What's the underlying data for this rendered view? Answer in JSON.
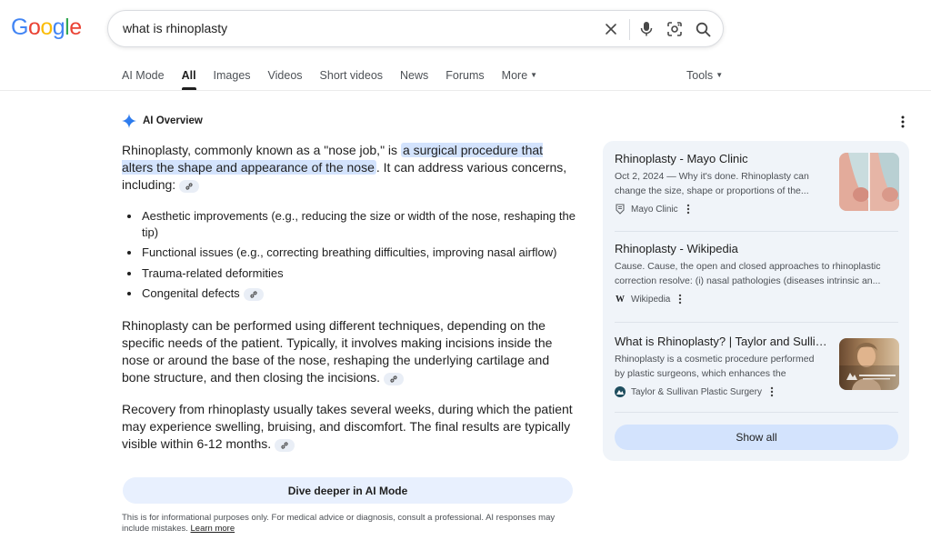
{
  "logo": {
    "letters": [
      "G",
      "o",
      "o",
      "g",
      "l",
      "e"
    ],
    "colors": [
      "#4285F4",
      "#EA4335",
      "#FBBC05",
      "#4285F4",
      "#34A853",
      "#EA4335"
    ]
  },
  "search": {
    "query": "what is rhinoplasty"
  },
  "icons": {
    "clear": "close-icon",
    "mic": "microphone-icon",
    "lens": "lens-camera-icon",
    "search": "search-icon",
    "overview": "sparkle-icon"
  },
  "tabs": [
    {
      "label": "AI Mode",
      "active": false
    },
    {
      "label": "All",
      "active": true
    },
    {
      "label": "Images",
      "active": false
    },
    {
      "label": "Videos",
      "active": false
    },
    {
      "label": "Short videos",
      "active": false
    },
    {
      "label": "News",
      "active": false
    },
    {
      "label": "Forums",
      "active": false
    },
    {
      "label": "More",
      "active": false
    }
  ],
  "tools_label": "Tools",
  "overview": {
    "heading": "AI Overview",
    "p1_pre": "Rhinoplasty, commonly known as a \"nose job,\" is ",
    "p1_highlight": "a surgical procedure that alters the shape and appearance of the nose",
    "p1_post": ". It can address various concerns, including:",
    "bullets": [
      "Aesthetic improvements (e.g., reducing the size or width of the nose, reshaping the tip)",
      "Functional issues (e.g., correcting breathing difficulties, improving nasal airflow)",
      "Trauma-related deformities",
      "Congenital defects"
    ],
    "p2": "Rhinoplasty can be performed using different techniques, depending on the specific needs of the patient. Typically, it involves making incisions inside the nose or around the base of the nose, reshaping the underlying cartilage and bone structure, and then closing the incisions.",
    "p3": "Recovery from rhinoplasty usually takes several weeks, during which the patient may experience swelling, bruising, and discomfort. The final results are typically visible within 6-12 months.",
    "dive_label": "Dive deeper in AI Mode",
    "disclaimer": "This is for informational purposes only. For medical advice or diagnosis, consult a professional. AI responses may include mistakes.",
    "learn_more": "Learn more"
  },
  "sources": [
    {
      "title": "Rhinoplasty - Mayo Clinic",
      "snippet": "Oct 2, 2024 — Why it's done. Rhinoplasty can change the size, shape or proportions of the...",
      "site": "Mayo Clinic"
    },
    {
      "title": "Rhinoplasty - Wikipedia",
      "snippet": "Cause. Cause, the open and closed approaches to rhinoplastic correction resolve: (i) nasal pathologies (diseases intrinsic an...",
      "site": "Wikipedia"
    },
    {
      "title": "What is Rhinoplasty? | Taylor and Sullivan",
      "snippet": "Rhinoplasty is a cosmetic procedure performed by plastic surgeons, which enhances the shape...",
      "site": "Taylor & Sullivan Plastic Surgery"
    }
  ],
  "show_all": "Show all"
}
